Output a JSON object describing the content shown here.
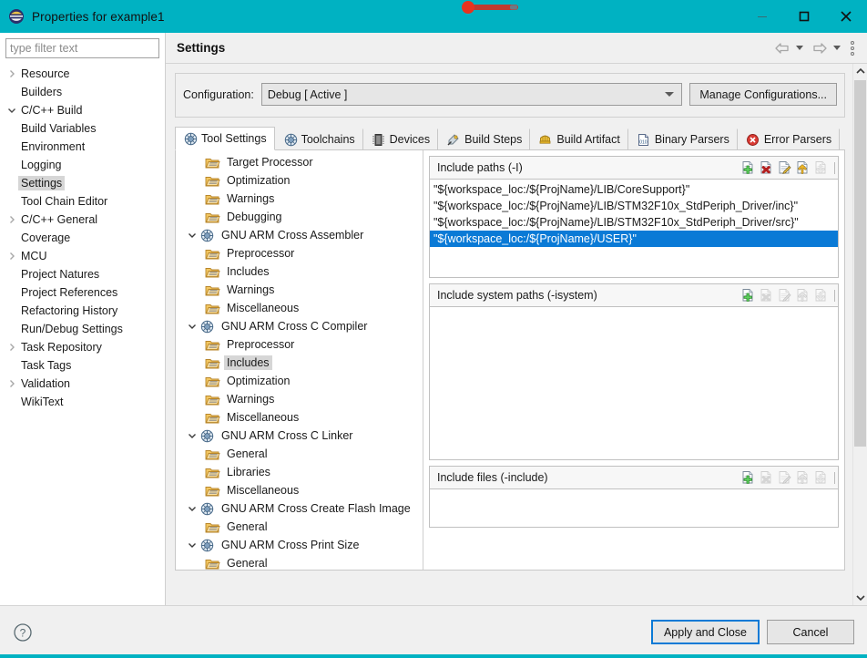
{
  "window": {
    "title": "Properties for example1",
    "icon": "eclipse-icon",
    "controls": {
      "minimize": "minimize-icon",
      "maximize": "maximize-icon",
      "close": "close-icon"
    },
    "titlebar_color": "#00b2c2"
  },
  "sidebar": {
    "filter": {
      "placeholder": "type filter text",
      "value": ""
    },
    "items": [
      {
        "label": "Resource",
        "expandable": true,
        "expanded": false,
        "indent": 0,
        "selected": false
      },
      {
        "label": "Builders",
        "expandable": false,
        "expanded": false,
        "indent": 0,
        "selected": false
      },
      {
        "label": "C/C++ Build",
        "expandable": true,
        "expanded": true,
        "indent": 0,
        "selected": false
      },
      {
        "label": "Build Variables",
        "expandable": false,
        "expanded": false,
        "indent": 1,
        "selected": false
      },
      {
        "label": "Environment",
        "expandable": false,
        "expanded": false,
        "indent": 1,
        "selected": false
      },
      {
        "label": "Logging",
        "expandable": false,
        "expanded": false,
        "indent": 1,
        "selected": false
      },
      {
        "label": "Settings",
        "expandable": false,
        "expanded": false,
        "indent": 1,
        "selected": true
      },
      {
        "label": "Tool Chain Editor",
        "expandable": false,
        "expanded": false,
        "indent": 1,
        "selected": false
      },
      {
        "label": "C/C++ General",
        "expandable": true,
        "expanded": false,
        "indent": 0,
        "selected": false
      },
      {
        "label": "Coverage",
        "expandable": false,
        "expanded": false,
        "indent": 0,
        "selected": false
      },
      {
        "label": "MCU",
        "expandable": true,
        "expanded": false,
        "indent": 0,
        "selected": false
      },
      {
        "label": "Project Natures",
        "expandable": false,
        "expanded": false,
        "indent": 0,
        "selected": false
      },
      {
        "label": "Project References",
        "expandable": false,
        "expanded": false,
        "indent": 0,
        "selected": false
      },
      {
        "label": "Refactoring History",
        "expandable": false,
        "expanded": false,
        "indent": 0,
        "selected": false
      },
      {
        "label": "Run/Debug Settings",
        "expandable": false,
        "expanded": false,
        "indent": 0,
        "selected": false
      },
      {
        "label": "Task Repository",
        "expandable": true,
        "expanded": false,
        "indent": 0,
        "selected": false
      },
      {
        "label": "Task Tags",
        "expandable": false,
        "expanded": false,
        "indent": 0,
        "selected": false
      },
      {
        "label": "Validation",
        "expandable": true,
        "expanded": false,
        "indent": 0,
        "selected": false
      },
      {
        "label": "WikiText",
        "expandable": false,
        "expanded": false,
        "indent": 0,
        "selected": false
      }
    ]
  },
  "header": {
    "title": "Settings",
    "back_icon": "back-arrow-icon",
    "forward_icon": "forward-arrow-icon",
    "menu_icon": "view-menu-icon"
  },
  "configuration": {
    "label": "Configuration:",
    "value": "Debug  [ Active ]",
    "manage_button": "Manage Configurations..."
  },
  "tabs": [
    {
      "label": "Tool Settings",
      "icon": "tool-settings-icon",
      "active": true
    },
    {
      "label": "Toolchains",
      "icon": "toolchains-icon",
      "active": false
    },
    {
      "label": "Devices",
      "icon": "devices-icon",
      "active": false
    },
    {
      "label": "Build Steps",
      "icon": "build-steps-icon",
      "active": false
    },
    {
      "label": "Build Artifact",
      "icon": "build-artifact-icon",
      "active": false
    },
    {
      "label": "Binary Parsers",
      "icon": "binary-parsers-icon",
      "active": false
    },
    {
      "label": "Error Parsers",
      "icon": "error-parsers-icon",
      "active": false
    }
  ],
  "tool_tree": [
    {
      "label": "Target Processor",
      "level": 1,
      "type": "folder",
      "expandable": false,
      "selected": false
    },
    {
      "label": "Optimization",
      "level": 1,
      "type": "folder",
      "expandable": false,
      "selected": false
    },
    {
      "label": "Warnings",
      "level": 1,
      "type": "folder",
      "expandable": false,
      "selected": false
    },
    {
      "label": "Debugging",
      "level": 1,
      "type": "folder",
      "expandable": false,
      "selected": false
    },
    {
      "label": "GNU ARM Cross Assembler",
      "level": 0,
      "type": "tool",
      "expandable": true,
      "selected": false
    },
    {
      "label": "Preprocessor",
      "level": 1,
      "type": "folder",
      "expandable": false,
      "selected": false
    },
    {
      "label": "Includes",
      "level": 1,
      "type": "folder",
      "expandable": false,
      "selected": false
    },
    {
      "label": "Warnings",
      "level": 1,
      "type": "folder",
      "expandable": false,
      "selected": false
    },
    {
      "label": "Miscellaneous",
      "level": 1,
      "type": "folder",
      "expandable": false,
      "selected": false
    },
    {
      "label": "GNU ARM Cross C Compiler",
      "level": 0,
      "type": "tool",
      "expandable": true,
      "selected": false
    },
    {
      "label": "Preprocessor",
      "level": 1,
      "type": "folder",
      "expandable": false,
      "selected": false
    },
    {
      "label": "Includes",
      "level": 1,
      "type": "folder",
      "expandable": false,
      "selected": true
    },
    {
      "label": "Optimization",
      "level": 1,
      "type": "folder",
      "expandable": false,
      "selected": false
    },
    {
      "label": "Warnings",
      "level": 1,
      "type": "folder",
      "expandable": false,
      "selected": false
    },
    {
      "label": "Miscellaneous",
      "level": 1,
      "type": "folder",
      "expandable": false,
      "selected": false
    },
    {
      "label": "GNU ARM Cross C Linker",
      "level": 0,
      "type": "tool",
      "expandable": true,
      "selected": false
    },
    {
      "label": "General",
      "level": 1,
      "type": "folder",
      "expandable": false,
      "selected": false
    },
    {
      "label": "Libraries",
      "level": 1,
      "type": "folder",
      "expandable": false,
      "selected": false
    },
    {
      "label": "Miscellaneous",
      "level": 1,
      "type": "folder",
      "expandable": false,
      "selected": false
    },
    {
      "label": "GNU ARM Cross Create Flash Image",
      "level": 0,
      "type": "tool",
      "expandable": true,
      "selected": false
    },
    {
      "label": "General",
      "level": 1,
      "type": "folder",
      "expandable": false,
      "selected": false
    },
    {
      "label": "GNU ARM Cross Print Size",
      "level": 0,
      "type": "tool",
      "expandable": true,
      "selected": false
    },
    {
      "label": "General",
      "level": 1,
      "type": "folder",
      "expandable": false,
      "selected": false
    }
  ],
  "option_groups": [
    {
      "title": "Include paths (-I)",
      "icons": [
        "add-icon",
        "delete-icon",
        "edit-icon",
        "move-up-icon",
        "move-down-icon"
      ],
      "icons_enabled": [
        true,
        true,
        true,
        true,
        false
      ],
      "entries": [
        {
          "text": "\"${workspace_loc:/${ProjName}/LIB/CoreSupport}\"",
          "selected": false
        },
        {
          "text": "\"${workspace_loc:/${ProjName}/LIB/STM32F10x_StdPeriph_Driver/inc}\"",
          "selected": false
        },
        {
          "text": "\"${workspace_loc:/${ProjName}/LIB/STM32F10x_StdPeriph_Driver/src}\"",
          "selected": false
        },
        {
          "text": "\"${workspace_loc:/${ProjName}/USER}\"",
          "selected": true
        }
      ]
    },
    {
      "title": "Include system paths (-isystem)",
      "icons": [
        "add-icon",
        "delete-icon",
        "edit-icon",
        "move-up-icon",
        "move-down-icon"
      ],
      "icons_enabled": [
        true,
        false,
        false,
        false,
        false
      ],
      "entries": []
    },
    {
      "title": "Include files (-include)",
      "icons": [
        "add-icon",
        "delete-icon",
        "edit-icon",
        "move-up-icon",
        "move-down-icon"
      ],
      "icons_enabled": [
        true,
        false,
        false,
        false,
        false
      ],
      "entries": []
    }
  ],
  "footer": {
    "help_icon": "help-icon",
    "apply_button": "Apply and Close",
    "cancel_button": "Cancel"
  },
  "colors": {
    "accent": "#00b2c2",
    "selection": "#0a7ad6",
    "tree_selection": "#d6d6d6"
  }
}
